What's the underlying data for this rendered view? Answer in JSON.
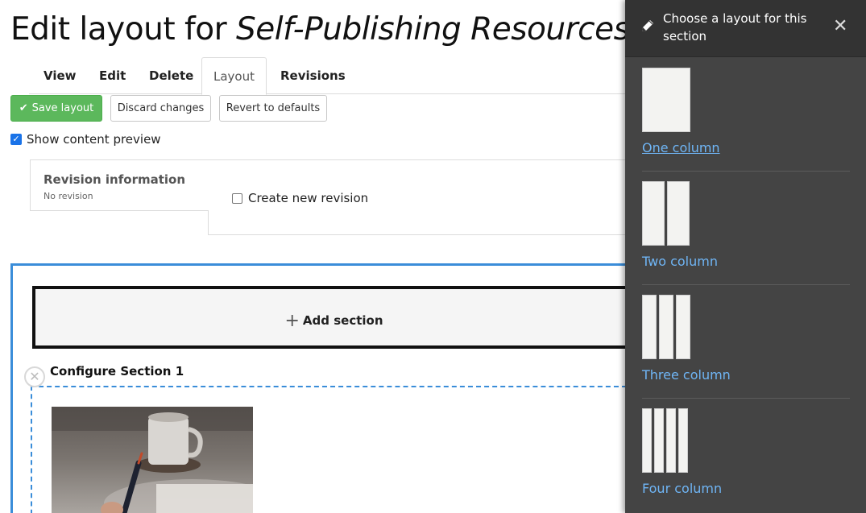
{
  "page": {
    "title_prefix": "Edit layout for ",
    "title_entity": "Self-Publishing Resources"
  },
  "tabs": [
    {
      "label": "View"
    },
    {
      "label": "Edit"
    },
    {
      "label": "Delete"
    },
    {
      "label": "Layout",
      "active": true
    },
    {
      "label": "Revisions"
    }
  ],
  "actions": {
    "save": "Save layout",
    "discard": "Discard changes",
    "revert": "Revert to defaults"
  },
  "preview": {
    "label": "Show content preview",
    "checked": true
  },
  "revision": {
    "title": "Revision information",
    "subtitle": "No revision",
    "create_new_label": "Create new revision",
    "create_new_checked": false
  },
  "builder": {
    "add_section": "Add section",
    "configure_section": "Configure Section 1"
  },
  "panel": {
    "title": "Choose a layout for this section",
    "close_symbol": "✕",
    "options": [
      {
        "label": "One column",
        "columns": 1
      },
      {
        "label": "Two column",
        "columns": 2
      },
      {
        "label": "Three column",
        "columns": 3
      },
      {
        "label": "Four column",
        "columns": 4
      }
    ]
  },
  "colors": {
    "primary_button": "#5cb85c",
    "builder_outline": "#3a8dd9",
    "panel_bg": "#444444",
    "panel_link": "#6fb5f5"
  }
}
